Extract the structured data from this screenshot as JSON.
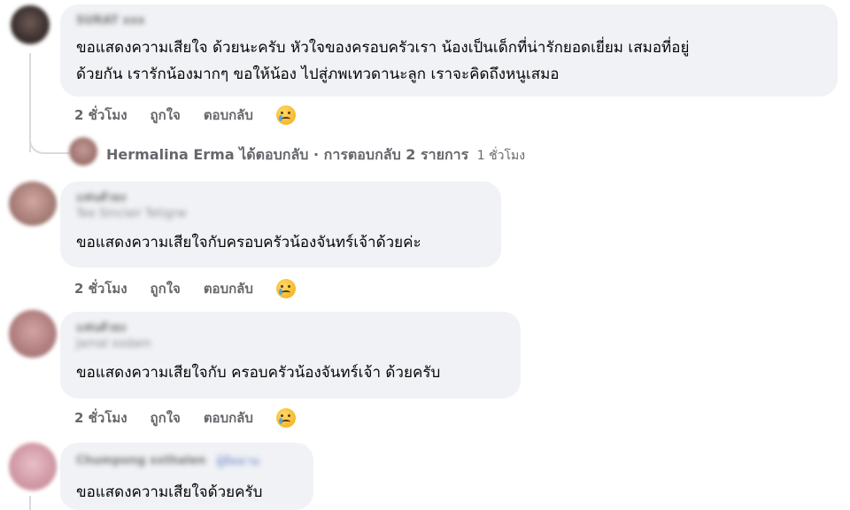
{
  "comments": [
    {
      "author_blurred": "SURAT xxx",
      "message_line1": "ขอแสดงความเสียใจ ด้วยนะครับ หัวใจของครอบครัวเรา น้องเป็นเด็กที่น่ารักยอดเยี่ยม เสมอที่อยู่",
      "message_line2": "ด้วยกัน เรารักน้องมากๆ ขอให้น้อง ไปสู่ภพเทวดานะลูก เราจะคิดถึงหนูเสมอ",
      "time": "2 ชั่วโมง",
      "like_label": "ถูกใจ",
      "reply_label": "ตอบกลับ",
      "reaction": "crying-face-icon"
    },
    {
      "author_blurred": "แฟนตัวยง",
      "sub_blurred": "Tee Sinclair Tetigrw",
      "message": "ขอแสดงความเสียใจกับครอบครัวน้องจันทร์เจ้าด้วยค่ะ",
      "time": "2 ชั่วโมง",
      "like_label": "ถูกใจ",
      "reply_label": "ตอบกลับ",
      "reaction": "crying-face-icon"
    },
    {
      "author_blurred": "แฟนตัวยง",
      "sub_blurred": "Jamal xxdam",
      "message": "ขอแสดงความเสียใจกับ ครอบครัวน้องจันทร์เจ้า ด้วยครับ",
      "time": "2 ชั่วโมง",
      "like_label": "ถูกใจ",
      "reply_label": "ตอบกลับ",
      "reaction": "crying-face-icon"
    },
    {
      "author_blurred": "Chumpong xxthalen",
      "tag_blurred": "ผู้ติดตาม",
      "message": "ขอแสดงความเสียใจด้วยครับ"
    }
  ],
  "replies_summary": {
    "text": "Hermalina Erma ได้ตอบกลับ · การตอบกลับ 2 รายการ",
    "time": "1 ชั่วโมง"
  }
}
